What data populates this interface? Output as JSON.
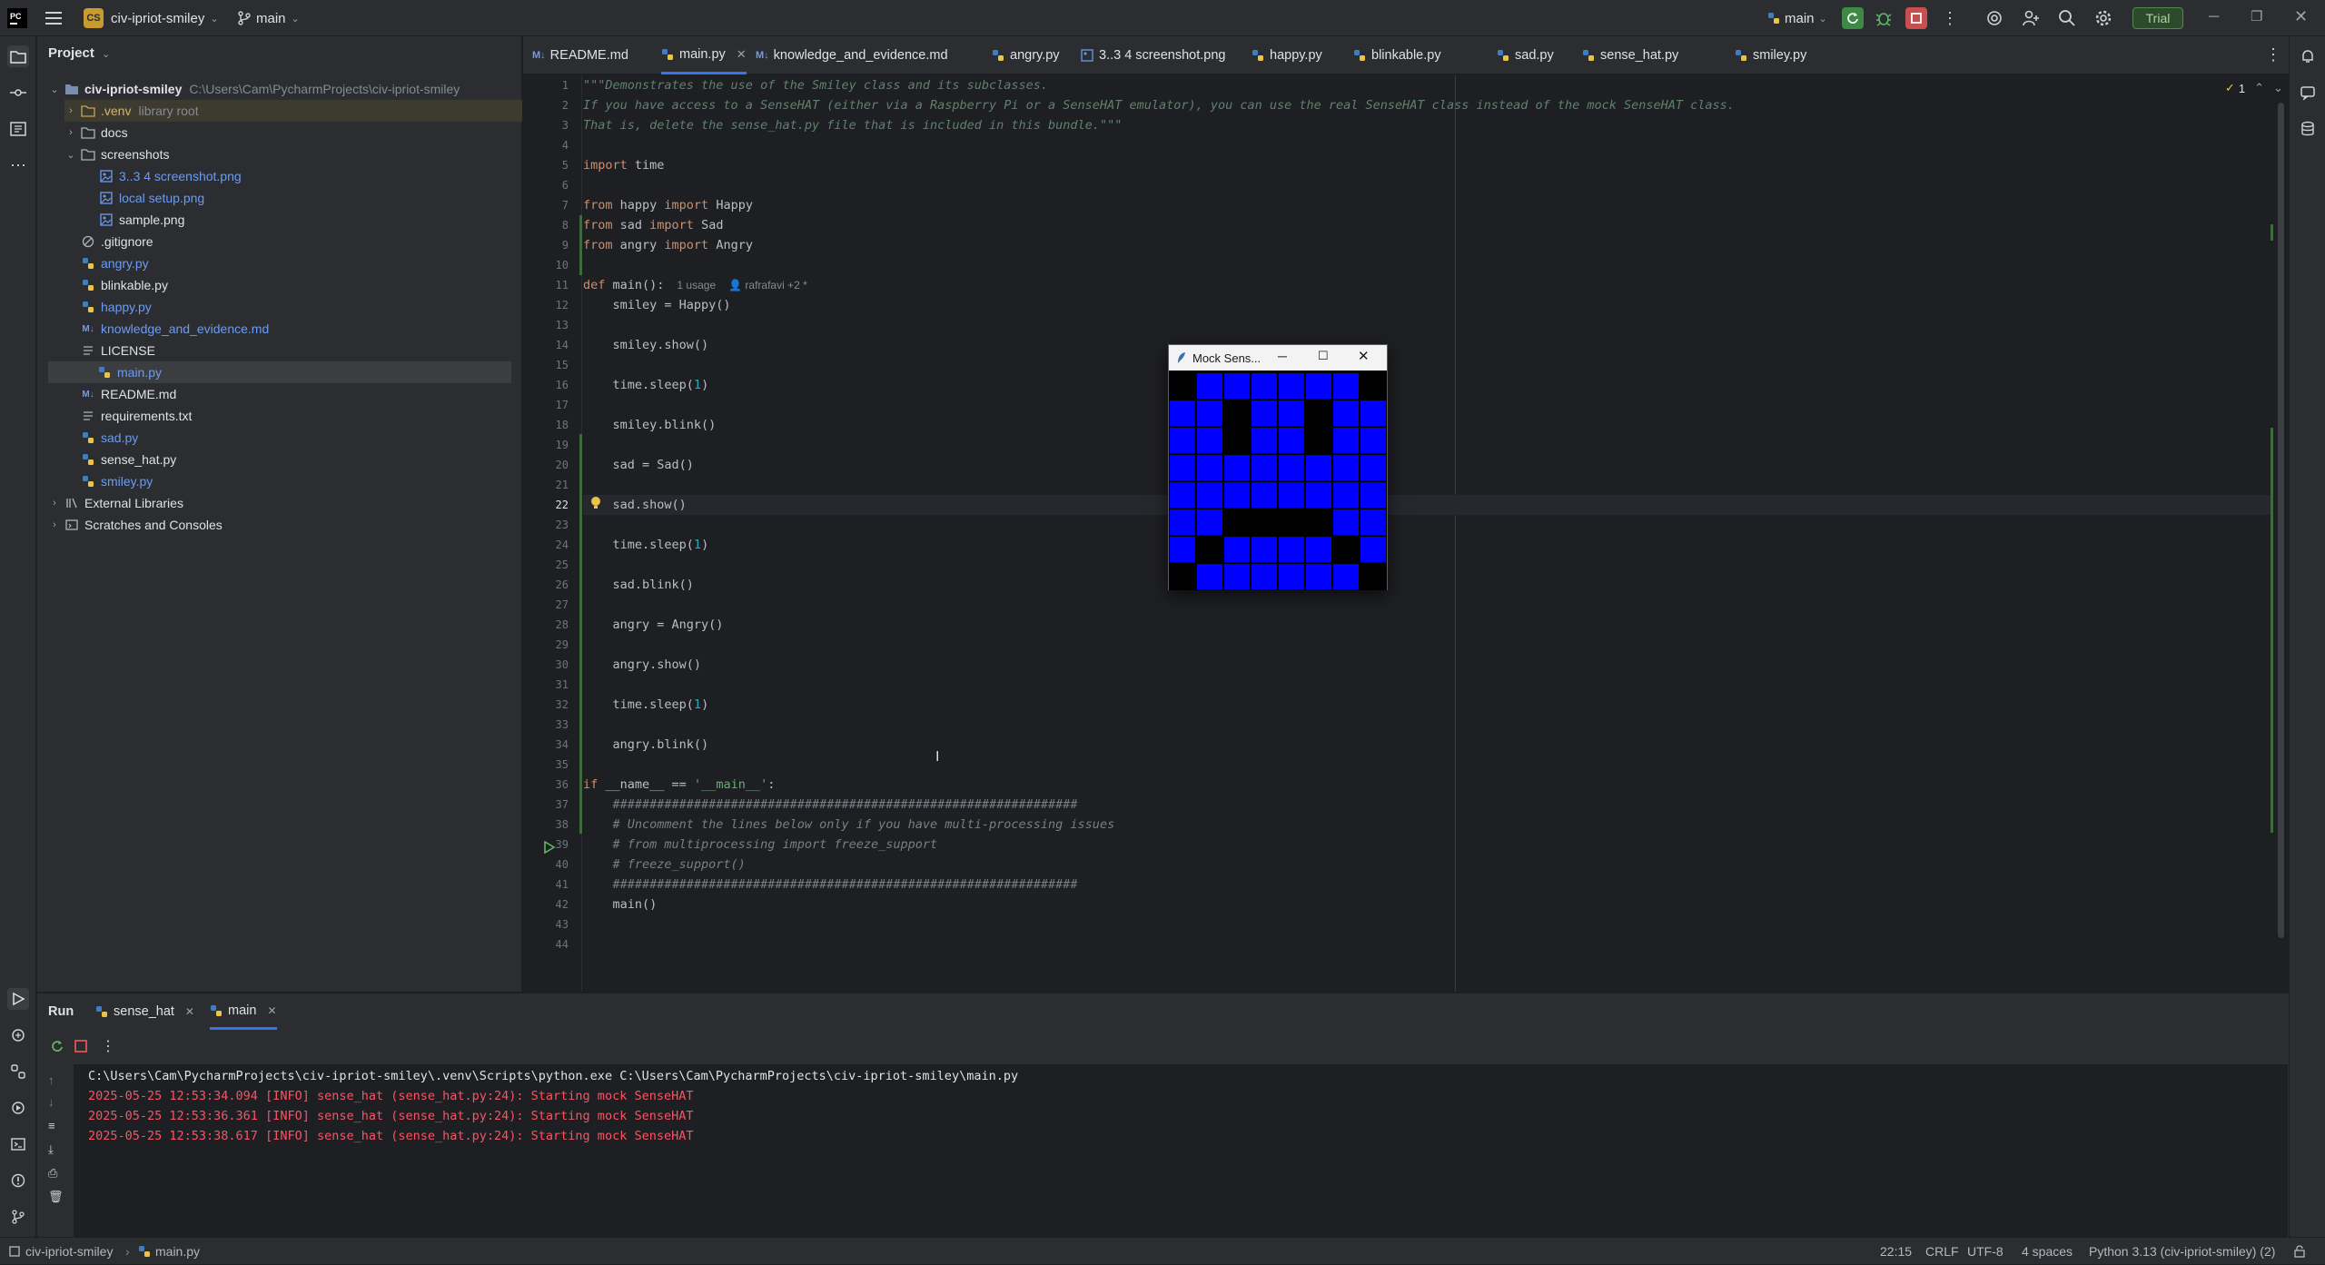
{
  "titlebar": {
    "project_badge": "CS",
    "project_name": "civ-ipriot-smiley",
    "vcs_branch": "main",
    "run_config": "main",
    "trial_label": "Trial"
  },
  "project_panel": {
    "header": "Project",
    "root_name": "civ-ipriot-smiley",
    "root_path": "C:\\Users\\Cam\\PycharmProjects\\civ-ipriot-smiley",
    "venv_name": ".venv",
    "venv_note": "library root",
    "items": [
      {
        "label": "docs",
        "kind": "folder"
      },
      {
        "label": "screenshots",
        "kind": "folder"
      },
      {
        "label": "3..3 4 screenshot.png",
        "kind": "image"
      },
      {
        "label": "local setup.png",
        "kind": "image"
      },
      {
        "label": "sample.png",
        "kind": "image"
      },
      {
        "label": ".gitignore",
        "kind": "ignore"
      },
      {
        "label": "angry.py",
        "kind": "py"
      },
      {
        "label": "blinkable.py",
        "kind": "py"
      },
      {
        "label": "happy.py",
        "kind": "py"
      },
      {
        "label": "knowledge_and_evidence.md",
        "kind": "md"
      },
      {
        "label": "LICENSE",
        "kind": "text"
      },
      {
        "label": "main.py",
        "kind": "py"
      },
      {
        "label": "README.md",
        "kind": "md"
      },
      {
        "label": "requirements.txt",
        "kind": "text"
      },
      {
        "label": "sad.py",
        "kind": "py"
      },
      {
        "label": "sense_hat.py",
        "kind": "py"
      },
      {
        "label": "smiley.py",
        "kind": "py"
      },
      {
        "label": "External Libraries",
        "kind": "lib"
      },
      {
        "label": "Scratches and Consoles",
        "kind": "scratch"
      }
    ]
  },
  "tabs": [
    {
      "label": "README.md",
      "kind": "md"
    },
    {
      "label": "main.py",
      "kind": "py"
    },
    {
      "label": "knowledge_and_evidence.md",
      "kind": "md"
    },
    {
      "label": "angry.py",
      "kind": "py"
    },
    {
      "label": "3..3 4 screenshot.png",
      "kind": "image"
    },
    {
      "label": "happy.py",
      "kind": "py"
    },
    {
      "label": "blinkable.py",
      "kind": "py"
    },
    {
      "label": "sad.py",
      "kind": "py"
    },
    {
      "label": "sense_hat.py",
      "kind": "py"
    },
    {
      "label": "smiley.py",
      "kind": "py"
    }
  ],
  "editor": {
    "inspection_count": "1",
    "current_line": "22",
    "usage_hint": "1 usage",
    "author_hint": "rafrafavi +2 *",
    "lines": [
      "\"\"\"Demonstrates the use of the Smiley class and its subclasses.",
      "If you have access to a SenseHAT (either via a Raspberry Pi or a SenseHAT emulator), you can use the real SenseHAT class instead of the mock SenseHAT class.",
      "That is, delete the sense_hat.py file that is included in this bundle.\"\"\"",
      "",
      "import time",
      "",
      "from happy import Happy",
      "from sad import Sad",
      "from angry import Angry",
      "",
      "def main():",
      "    smiley = Happy()",
      "",
      "    smiley.show()",
      "",
      "    time.sleep(1)",
      "",
      "    smiley.blink()",
      "",
      "    sad = Sad()",
      "",
      "    sad.show()",
      "",
      "    time.sleep(1)",
      "",
      "    sad.blink()",
      "",
      "    angry = Angry()",
      "",
      "    angry.show()",
      "",
      "    time.sleep(1)",
      "",
      "    angry.blink()",
      "",
      "if __name__ == '__main__':",
      "    ###############################################################",
      "    # Uncomment the lines below only if you have multi-processing issues",
      "    # from multiprocessing import freeze_support",
      "    # freeze_support()",
      "    ###############################################################",
      "    main()",
      "",
      ""
    ]
  },
  "mock_window": {
    "title": "Mock Sens...",
    "on_color": "#0000ff",
    "off_color": "#000000",
    "pixels": [
      [
        0,
        1,
        1,
        1,
        1,
        1,
        1,
        0
      ],
      [
        1,
        1,
        0,
        1,
        1,
        0,
        1,
        1
      ],
      [
        1,
        1,
        0,
        1,
        1,
        0,
        1,
        1
      ],
      [
        1,
        1,
        1,
        1,
        1,
        1,
        1,
        1
      ],
      [
        1,
        1,
        1,
        1,
        1,
        1,
        1,
        1
      ],
      [
        1,
        1,
        0,
        0,
        0,
        0,
        1,
        1
      ],
      [
        1,
        0,
        1,
        1,
        1,
        1,
        0,
        1
      ],
      [
        0,
        1,
        1,
        1,
        1,
        1,
        1,
        0
      ]
    ]
  },
  "run_panel": {
    "title": "Run",
    "tabs": [
      {
        "label": "sense_hat"
      },
      {
        "label": "main"
      }
    ],
    "command": "C:\\Users\\Cam\\PycharmProjects\\civ-ipriot-smiley\\.venv\\Scripts\\python.exe C:\\Users\\Cam\\PycharmProjects\\civ-ipriot-smiley\\main.py",
    "log_lines": [
      "2025-05-25 12:53:34.094 [INFO] sense_hat (sense_hat.py:24): Starting mock SenseHAT",
      "2025-05-25 12:53:36.361 [INFO] sense_hat (sense_hat.py:24): Starting mock SenseHAT",
      "2025-05-25 12:53:38.617 [INFO] sense_hat (sense_hat.py:24): Starting mock SenseHAT"
    ]
  },
  "statusbar": {
    "project": "civ-ipriot-smiley",
    "file": "main.py",
    "position": "22:15",
    "line_sep": "CRLF",
    "encoding": "UTF-8",
    "indent": "4 spaces",
    "interpreter": "Python 3.13 (civ-ipriot-smiley) (2)"
  },
  "colors": {
    "accent": "#3574f0",
    "error_text": "#f75464",
    "trial_green": "#4e8a4b"
  }
}
